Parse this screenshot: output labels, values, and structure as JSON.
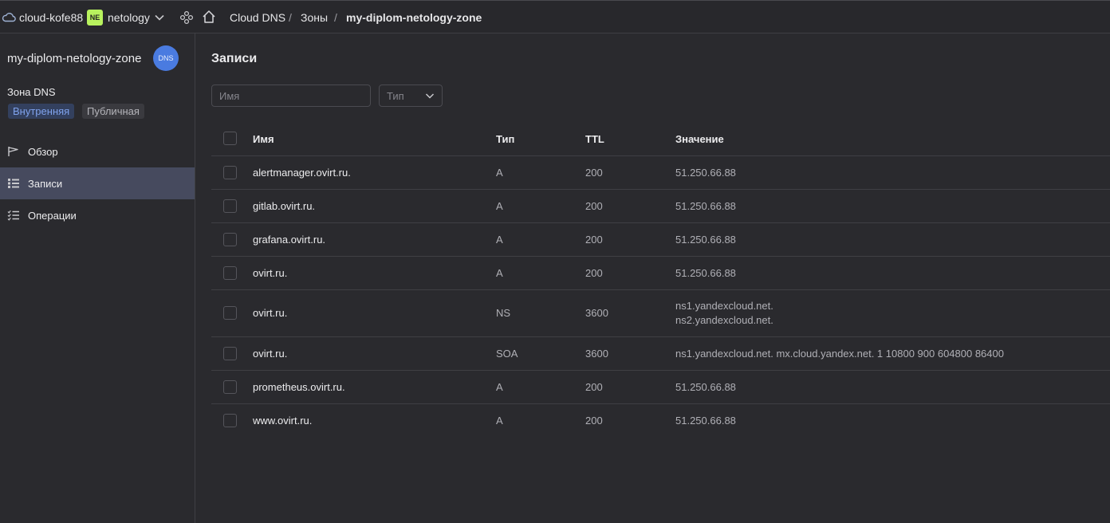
{
  "header": {
    "cloud_name": "cloud-kofe88",
    "org_badge": "NE",
    "org_name": "netology",
    "breadcrumbs": [
      "Cloud DNS",
      "Зоны",
      "my-diplom-netology-zone"
    ],
    "separator": "/"
  },
  "sidebar": {
    "zone_title": "my-diplom-netology-zone",
    "avatar_text": "DNS",
    "zone_subtitle": "Зона DNS",
    "chips": [
      "Внутренняя",
      "Публичная"
    ],
    "nav": [
      {
        "label": "Обзор",
        "icon": "flag-icon",
        "active": false
      },
      {
        "label": "Записи",
        "icon": "list-icon",
        "active": true
      },
      {
        "label": "Операции",
        "icon": "checklist-icon",
        "active": false
      }
    ]
  },
  "main": {
    "title": "Записи",
    "filter_name_placeholder": "Имя",
    "filter_type_placeholder": "Тип",
    "columns": [
      "Имя",
      "Тип",
      "TTL",
      "Значение"
    ],
    "records": [
      {
        "name": "alertmanager.ovirt.ru.",
        "type": "A",
        "ttl": "200",
        "values": [
          "51.250.66.88"
        ]
      },
      {
        "name": "gitlab.ovirt.ru.",
        "type": "A",
        "ttl": "200",
        "values": [
          "51.250.66.88"
        ]
      },
      {
        "name": "grafana.ovirt.ru.",
        "type": "A",
        "ttl": "200",
        "values": [
          "51.250.66.88"
        ]
      },
      {
        "name": "ovirt.ru.",
        "type": "A",
        "ttl": "200",
        "values": [
          "51.250.66.88"
        ]
      },
      {
        "name": "ovirt.ru.",
        "type": "NS",
        "ttl": "3600",
        "values": [
          "ns1.yandexcloud.net.",
          "ns2.yandexcloud.net."
        ]
      },
      {
        "name": "ovirt.ru.",
        "type": "SOA",
        "ttl": "3600",
        "values": [
          "ns1.yandexcloud.net. mx.cloud.yandex.net. 1 10800 900 604800 86400"
        ]
      },
      {
        "name": "prometheus.ovirt.ru.",
        "type": "A",
        "ttl": "200",
        "values": [
          "51.250.66.88"
        ]
      },
      {
        "name": "www.ovirt.ru.",
        "type": "A",
        "ttl": "200",
        "values": [
          "51.250.66.88"
        ]
      }
    ]
  },
  "colors": {
    "background": "#2a2a2e",
    "accent": "#4a7be0",
    "org_badge": "#b8f25e",
    "active_nav": "#464a5e"
  }
}
